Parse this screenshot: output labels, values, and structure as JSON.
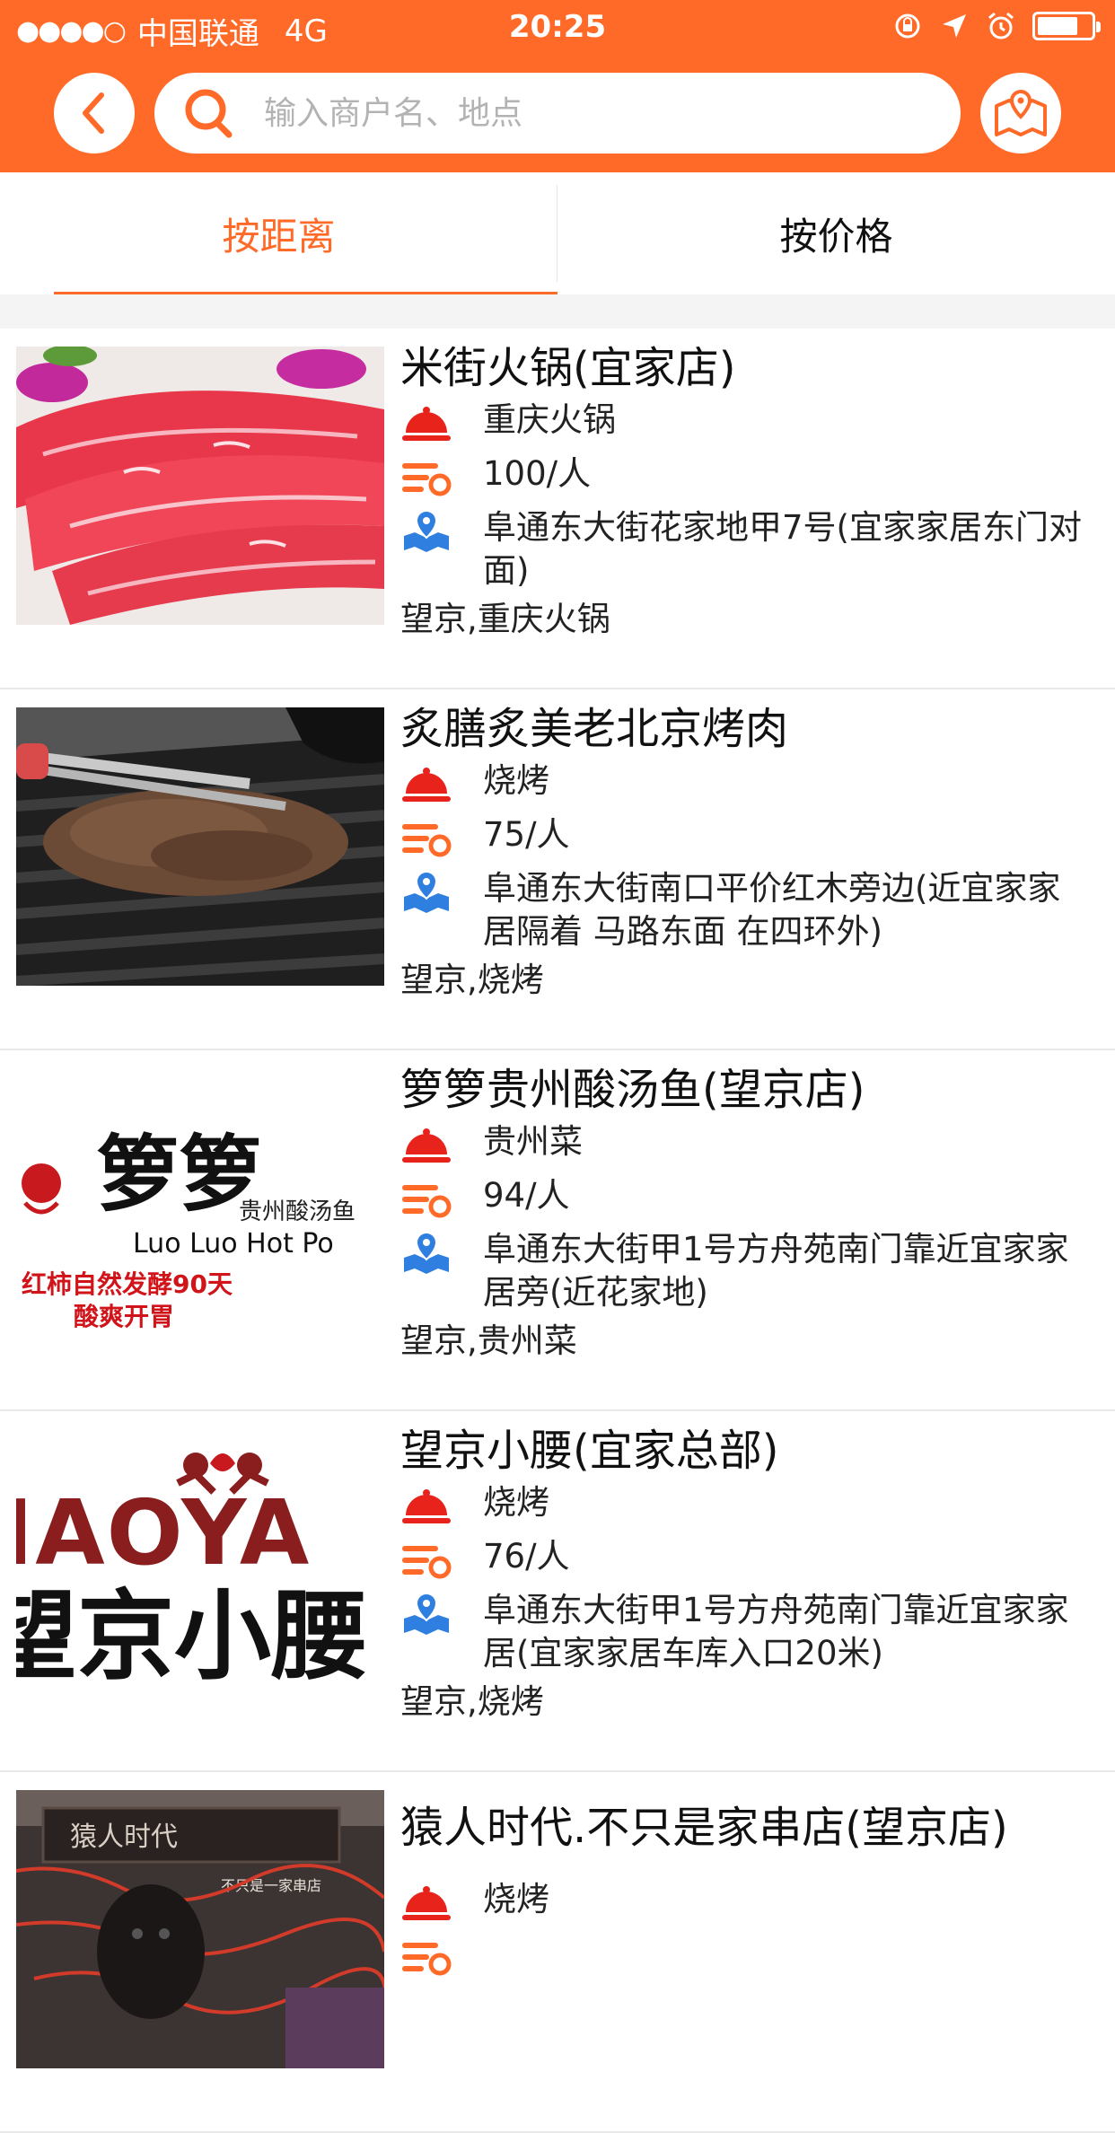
{
  "status_bar": {
    "signal": "●●●●○",
    "carrier": "中国联通",
    "network": "4G",
    "time": "20:25"
  },
  "search": {
    "placeholder": "输入商户名、地点"
  },
  "tabs": [
    {
      "label": "按距离",
      "active": true
    },
    {
      "label": "按价格",
      "active": false
    }
  ],
  "colors": {
    "accent": "#ff6a28",
    "category_icon": "#e8231c",
    "price_icon": "#ff6a28",
    "address_icon": "#2f7fe0"
  },
  "restaurants": [
    {
      "name": "米街火锅(宜家店)",
      "category": "重庆火锅",
      "price": "100/人",
      "address": "阜通东大街花家地甲7号(宜家家居东门对面)",
      "tags": "望京,重庆火锅",
      "image": "raw-beef-photo"
    },
    {
      "name": "炙膳炙美老北京烤肉",
      "category": "烧烤",
      "price": "75/人",
      "address": "阜通东大街南口平价红木旁边(近宜家家居隔着 马路东面  在四环外)",
      "tags": "望京,烧烤",
      "image": "grill-meat-photo"
    },
    {
      "name": "箩箩贵州酸汤鱼(望京店)",
      "category": "贵州菜",
      "price": "94/人",
      "address": "阜通东大街甲1号方舟苑南门靠近宜家家居旁(近花家地)",
      "tags": "望京,贵州菜",
      "image": "luoluo-logo",
      "image_text": {
        "brand": "箩箩",
        "cn_sub": "贵州酸汤鱼",
        "en": "Luo Luo Hot Po",
        "slogan1": "红柿自然发酵90天",
        "slogan2": "酸爽开胃"
      }
    },
    {
      "name": "望京小腰(宜家总部)",
      "category": "烧烤",
      "price": "76/人",
      "address": "阜通东大街甲1号方舟苑南门靠近宜家家居(宜家家居车库入口20米)",
      "tags": "望京,烧烤",
      "image": "xiaoyao-logo",
      "image_text": {
        "line1": "IAOYA",
        "line2": "望京小腰"
      }
    },
    {
      "name": "猿人时代.不只是家串店(望京店)",
      "category": "烧烤",
      "price": "",
      "address": "",
      "tags": "",
      "image": "storefront-photo",
      "image_text": {
        "sign": "猿人时代",
        "sub": "不只是一家串店"
      }
    }
  ]
}
